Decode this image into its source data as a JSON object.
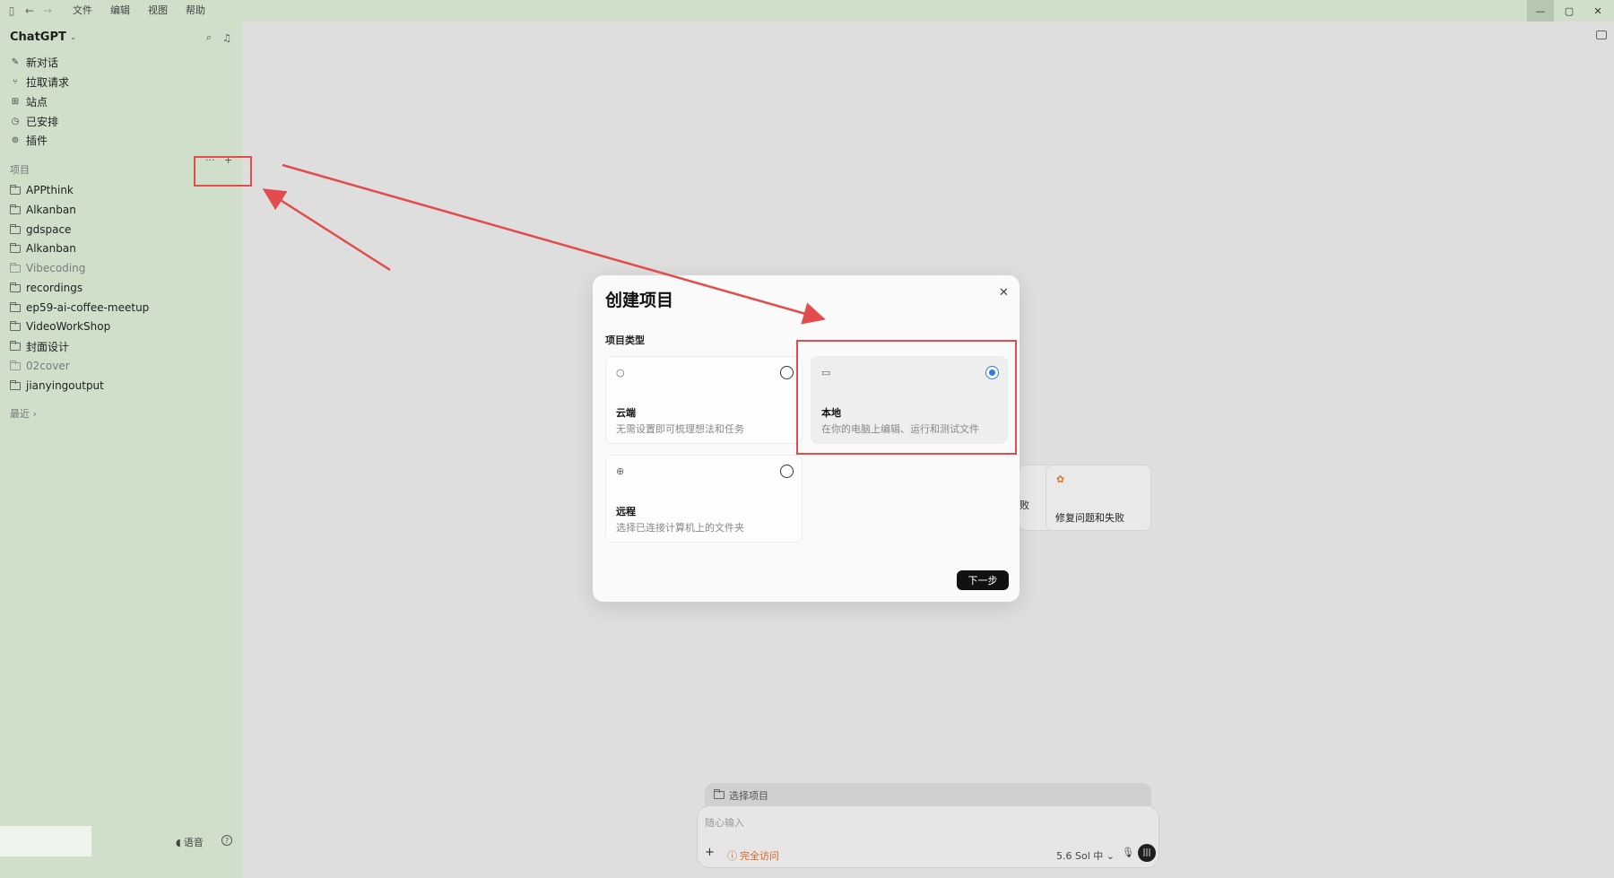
{
  "titlebar": {
    "menu": [
      "文件",
      "编辑",
      "视图",
      "帮助"
    ]
  },
  "sidebar": {
    "brand": "ChatGPT",
    "nav": [
      {
        "label": "新对话",
        "icon": "edit-icon"
      },
      {
        "label": "拉取请求",
        "icon": "pull-request-icon"
      },
      {
        "label": "站点",
        "icon": "sites-icon"
      },
      {
        "label": "已安排",
        "icon": "clock-icon"
      },
      {
        "label": "插件",
        "icon": "plugin-icon"
      }
    ],
    "projects_label": "项目",
    "projects_more": "···",
    "projects_add": "+",
    "projects": [
      {
        "label": "APPthink"
      },
      {
        "label": "Alkanban"
      },
      {
        "label": "gdspace"
      },
      {
        "label": "Alkanban"
      },
      {
        "label": "Vibecoding"
      },
      {
        "label": "recordings"
      },
      {
        "label": "ep59-ai-coffee-meetup"
      },
      {
        "label": "VideoWorkShop"
      },
      {
        "label": "封面设计"
      },
      {
        "label": "02cover"
      },
      {
        "label": "jianyingoutput"
      }
    ],
    "recent_label": "最近",
    "voice_label": "语音"
  },
  "main": {
    "suggestions": [
      {
        "label": "败"
      },
      {
        "label": "修复问题和失败"
      }
    ],
    "composer": {
      "project_select": "选择项目",
      "placeholder": "随心输入",
      "access": "完全访问",
      "model": "5.6 Sol 中"
    }
  },
  "modal": {
    "title": "创建项目",
    "subtitle": "项目类型",
    "options": [
      {
        "title": "云端",
        "desc": "无需设置即可梳理想法和任务",
        "selected": false
      },
      {
        "title": "本地",
        "desc": "在你的电脑上编辑、运行和测试文件",
        "selected": true
      },
      {
        "title": "远程",
        "desc": "选择已连接计算机上的文件夹",
        "selected": false
      }
    ],
    "next": "下一步"
  },
  "colors": {
    "sidebar_bg": "#cfdfca",
    "highlight_red": "#e24c4c",
    "radio_blue": "#2e7be8",
    "access_orange": "#d9661f"
  }
}
